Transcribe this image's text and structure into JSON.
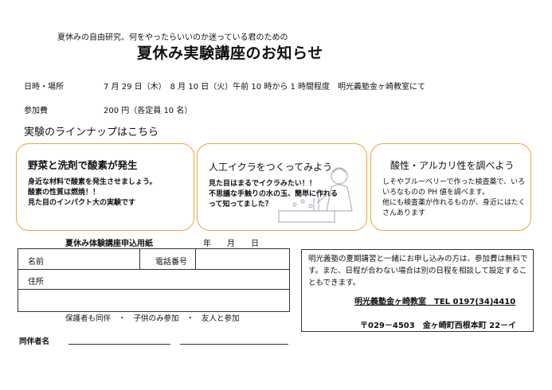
{
  "header": {
    "subtitle": "夏休みの自由研究、何をやったらいいのか迷っている君のための",
    "title": "夏休み実験講座のお知らせ"
  },
  "info": {
    "date_label": "日時・場所",
    "date_value": "7 月 29 日（木）　8 月 10 日（火）午前 10 時から 1 時間程度　明光義塾金ヶ崎教室にて",
    "fee_label": "参加費",
    "fee_value": "200 円（各定員 10 名）"
  },
  "lineup": {
    "heading": "実験のラインナップはこちら",
    "cards": [
      {
        "title": "野菜と洗剤で酸素が発生",
        "lines": [
          "身近な材料で酸素を発生させましょう。",
          "酸素の性質は燃焼！！",
          "見た目のインパクト大の実験です"
        ]
      },
      {
        "title": "人工イクラをつくってみよう",
        "lines": [
          "見た目はまるでイクラみたい！！",
          "不思議な手触りの水の玉、簡単に作れる",
          "って知ってました？"
        ]
      },
      {
        "title": "酸性・アルカリ性を調べよう",
        "lines": [
          "しそやブルーベリーで作った検査薬で、いろ",
          "いろなものの PH 値を調べます。",
          "他にも検査薬が作れるものが、身近にはたく",
          "さんあります"
        ]
      }
    ]
  },
  "form": {
    "title": "夏休み体験講座申込用紙",
    "date_template": "年　　月　　日",
    "name_label": "名前",
    "phone_label": "電話番号",
    "address_label": "住所",
    "options": "保護者も同伴　・　子供のみ参加　・　友人と参加",
    "companion_label": "同伴者名"
  },
  "note": {
    "text": "明光義塾の夏期講習と一緒にお申し込みの方は、参加費は無料です。また、日程が合わない場合は別の日程を相談して設定することもできます。",
    "contact": "明光義塾金ヶ崎教室　TEL 0197(34)4410",
    "address": "〒029－4503　金ヶ崎町西根本町 22－イ"
  },
  "colors": {
    "card_border": "#f0a53a"
  }
}
